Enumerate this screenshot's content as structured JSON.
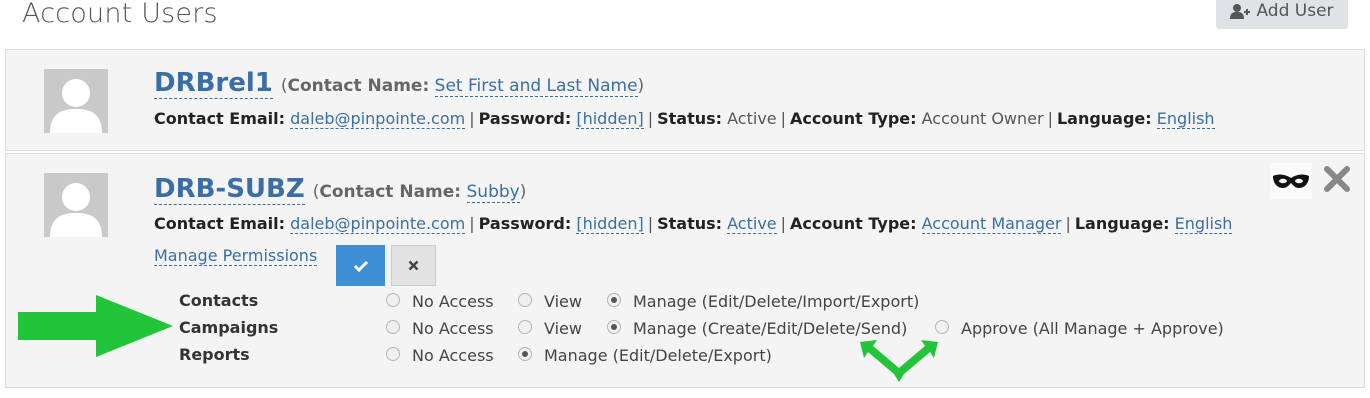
{
  "header": {
    "title": "Account Users",
    "add_user_label": "Add User",
    "add_user_icon": "user-plus-icon"
  },
  "users": [
    {
      "username": "DRBrel1",
      "contact_name_label": "Contact Name:",
      "contact_name": "Set First and Last Name",
      "email_label": "Contact Email:",
      "email": "daleb@pinpointe.com",
      "password_label": "Password:",
      "password": "[hidden]",
      "status_label": "Status:",
      "status": "Active",
      "account_type_label": "Account Type:",
      "account_type": "Account Owner",
      "language_label": "Language:",
      "language": "English"
    },
    {
      "username": "DRB-SUBZ",
      "contact_name_label": "Contact Name:",
      "contact_name": "Subby",
      "email_label": "Contact Email:",
      "email": "daleb@pinpointe.com",
      "password_label": "Password:",
      "password": "[hidden]",
      "status_label": "Status:",
      "status": "Active",
      "account_type_label": "Account Type:",
      "account_type": "Account Manager",
      "language_label": "Language:",
      "language": "English",
      "manage_permissions_label": "Manage Permissions",
      "permissions": [
        {
          "name": "Contacts",
          "options": [
            {
              "label": "No Access",
              "checked": false
            },
            {
              "label": "View",
              "checked": false
            },
            {
              "label": "Manage (Edit/Delete/Import/Export)",
              "checked": true
            }
          ]
        },
        {
          "name": "Campaigns",
          "options": [
            {
              "label": "No Access",
              "checked": false
            },
            {
              "label": "View",
              "checked": false
            },
            {
              "label": "Manage (Create/Edit/Delete/Send)",
              "checked": true
            },
            {
              "label": "Approve (All Manage + Approve)",
              "checked": false
            }
          ]
        },
        {
          "name": "Reports",
          "options": [
            {
              "label": "No Access",
              "checked": false
            },
            {
              "label": "Manage (Edit/Delete/Export)",
              "checked": true
            }
          ]
        }
      ]
    }
  ],
  "colors": {
    "accent": "#3a6ea5",
    "confirm_button": "#3d8fd6",
    "arrow_annotation": "#22c43a"
  }
}
